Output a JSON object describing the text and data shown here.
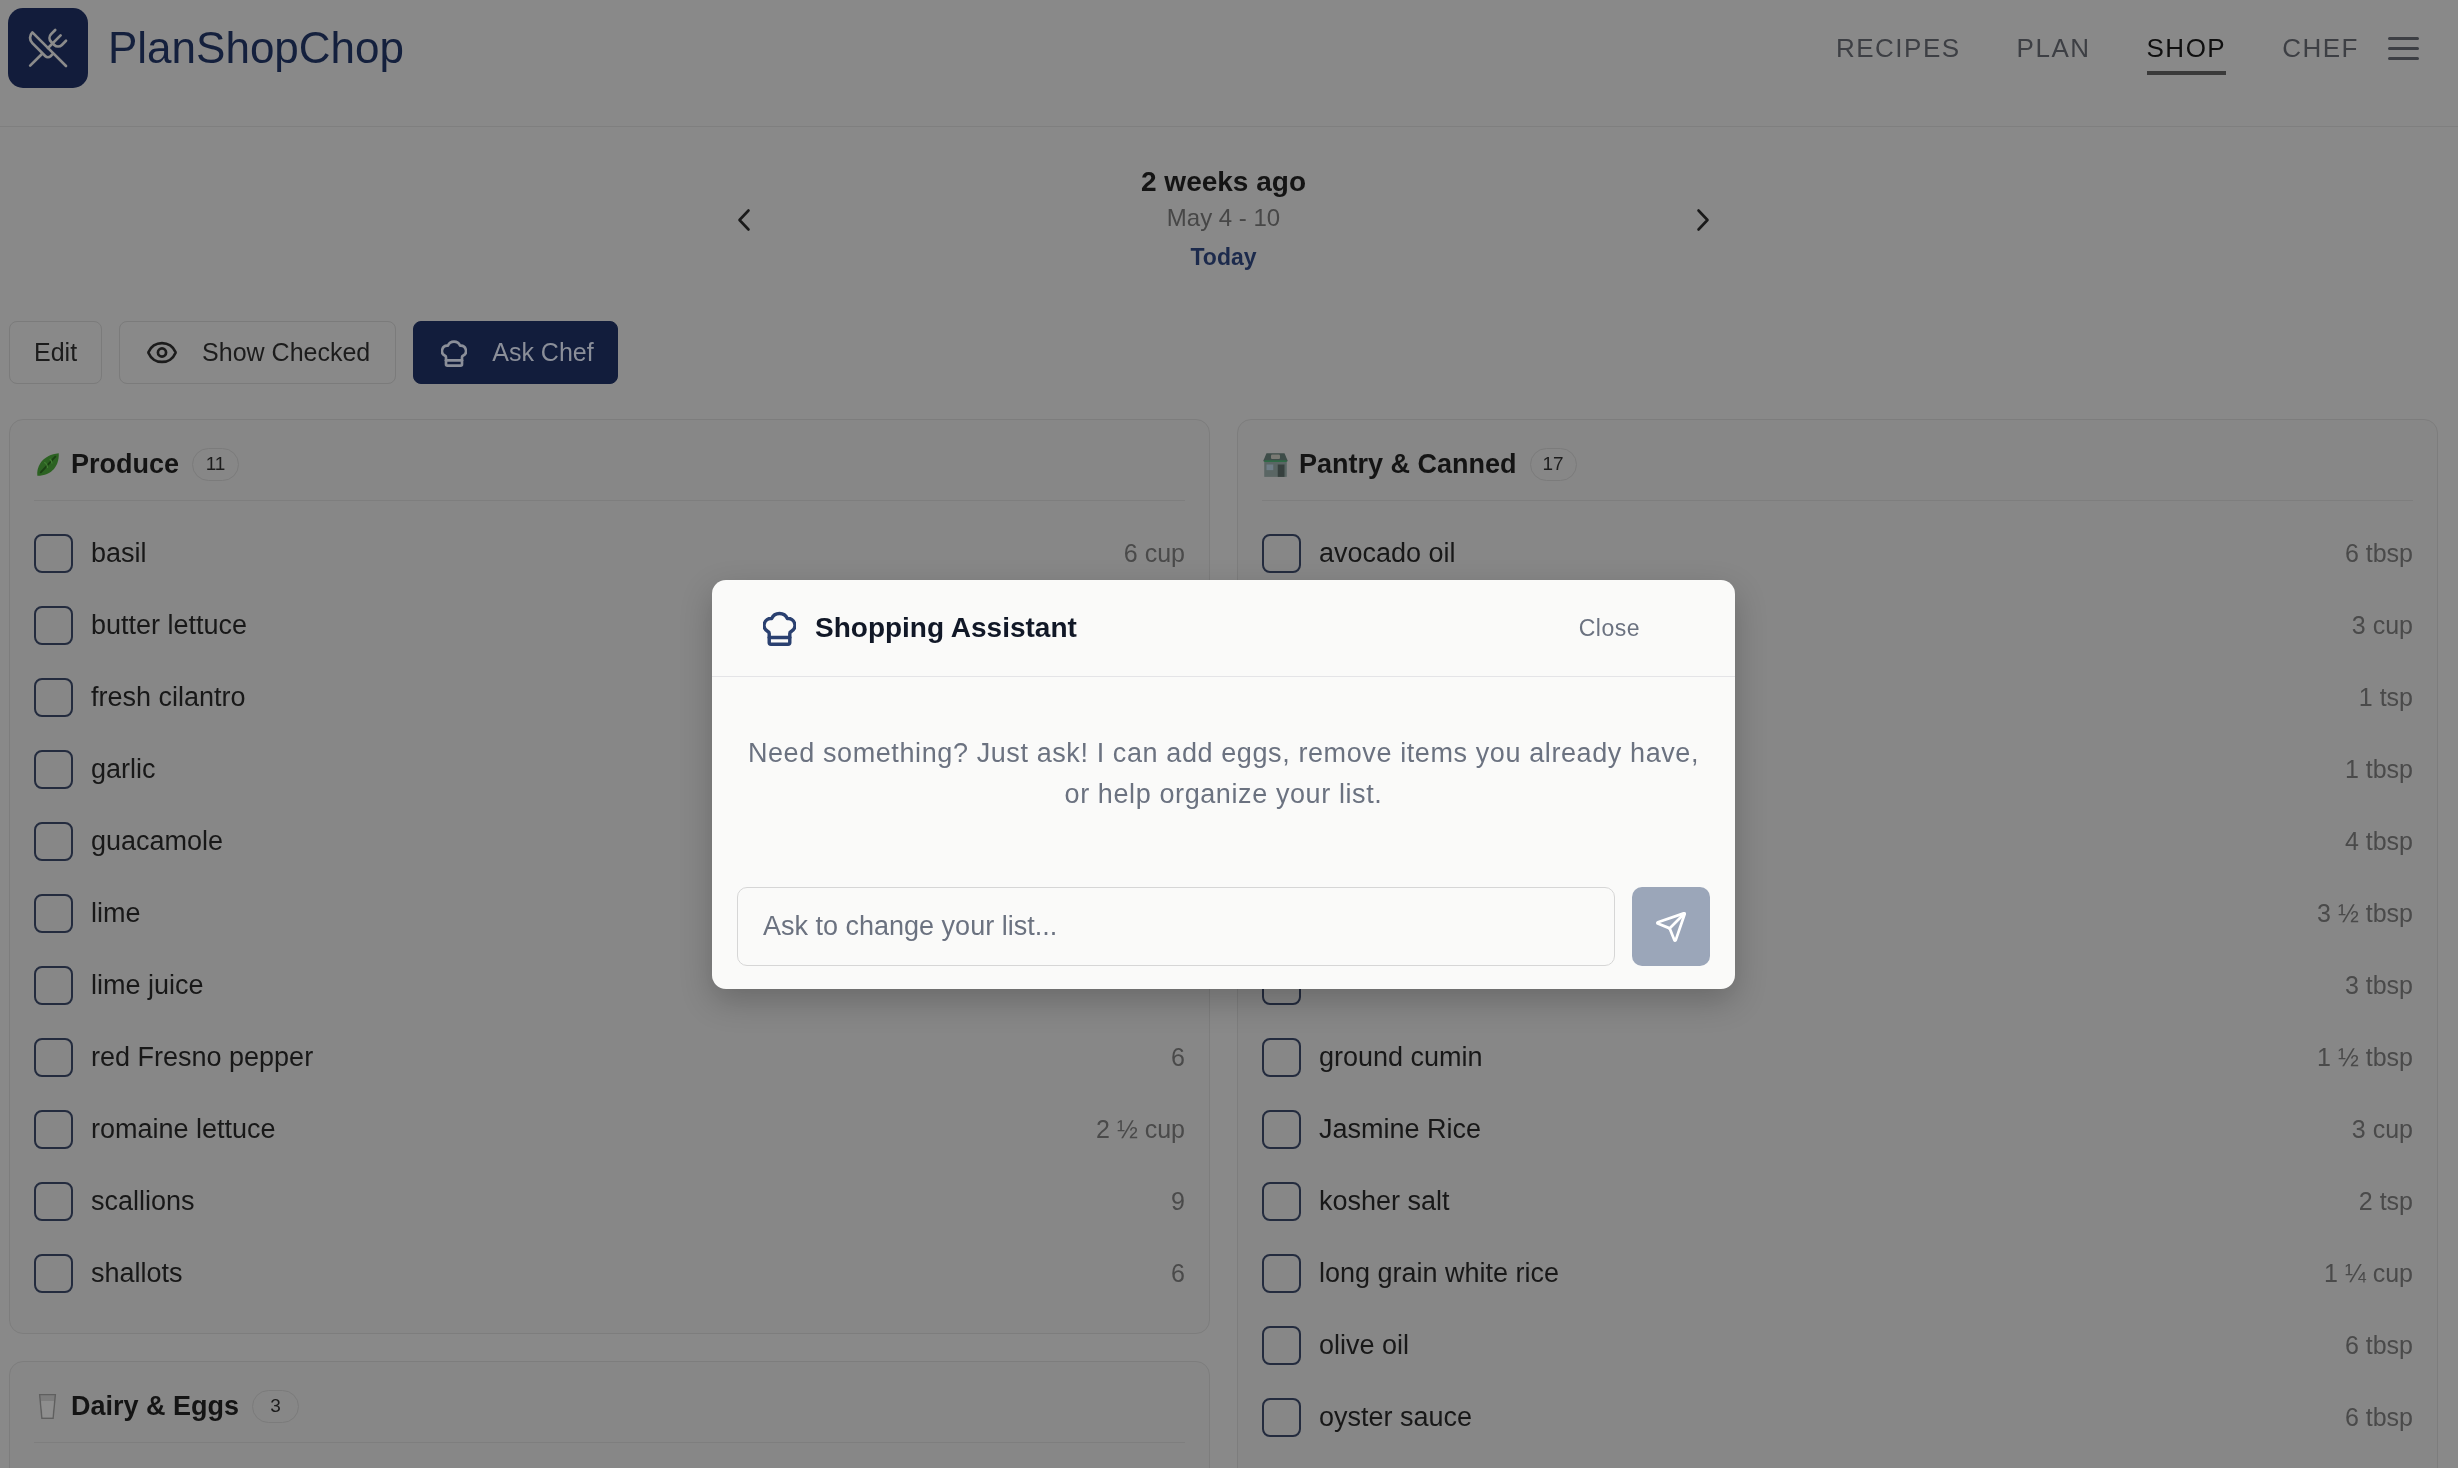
{
  "header": {
    "brand": "PlanShopChop",
    "nav": [
      {
        "label": "RECIPES",
        "selected": false
      },
      {
        "label": "PLAN",
        "selected": false
      },
      {
        "label": "SHOP",
        "selected": true
      },
      {
        "label": "CHEF",
        "selected": false
      }
    ]
  },
  "week": {
    "title": "2 weeks ago",
    "range": "May 4 - 10",
    "today": "Today"
  },
  "actions": [
    {
      "label": "Edit",
      "kind": "text"
    },
    {
      "label": "Show Checked",
      "kind": "toggle"
    },
    {
      "label": "Ask Chef",
      "kind": "assistant"
    }
  ],
  "columns": [
    {
      "categories": [
        {
          "kind": "produce",
          "title": "Produce",
          "count": "11",
          "items": [
            {
              "name": "basil",
              "checked": false,
              "quantity": "6 cup"
            },
            {
              "name": "butter lettuce",
              "checked": false
            },
            {
              "name": "fresh cilantro",
              "checked": false
            },
            {
              "name": "garlic",
              "checked": false
            },
            {
              "name": "guacamole",
              "checked": false
            },
            {
              "name": "lime",
              "checked": false
            },
            {
              "name": "lime juice",
              "checked": false
            },
            {
              "name": "red Fresno pepper",
              "checked": false,
              "quantity": "6"
            },
            {
              "name": "romaine lettuce",
              "checked": false,
              "quantity": "2 ½ cup"
            },
            {
              "name": "scallions",
              "checked": false,
              "quantity": "9"
            },
            {
              "name": "shallots",
              "checked": false,
              "quantity": "6"
            }
          ]
        },
        {
          "kind": "dairy",
          "title": "Dairy & Eggs",
          "count": "3"
        }
      ]
    },
    {
      "categories": [
        {
          "kind": "pantry",
          "title": "Pantry & Canned",
          "count": "17",
          "items": [
            {
              "name": "avocado oil",
              "checked": false,
              "quantity": "6 tbsp"
            },
            {
              "quantity": "3 cup"
            },
            {
              "quantity": "1 tsp"
            },
            {
              "quantity": "1 tbsp"
            },
            {
              "quantity": "4 tbsp"
            },
            {
              "quantity": "3 ½ tbsp"
            },
            {
              "checked": false,
              "quantity": "3 tbsp"
            },
            {
              "name": "ground cumin",
              "checked": false,
              "quantity": "1 ½ tbsp"
            },
            {
              "name": "Jasmine Rice",
              "checked": false,
              "quantity": "3 cup"
            },
            {
              "name": "kosher salt",
              "checked": false,
              "quantity": "2 tsp"
            },
            {
              "name": "long grain white rice",
              "checked": false,
              "quantity": "1 ¼ cup"
            },
            {
              "name": "olive oil",
              "checked": false,
              "quantity": "6 tbsp"
            },
            {
              "name": "oyster sauce",
              "checked": false,
              "quantity": "6 tbsp"
            }
          ]
        }
      ]
    }
  ],
  "assistant": {
    "title": "Shopping Assistant",
    "close": "Close",
    "message": "Need something? Just ask! I can add eggs, remove items you already have, or help organize your list.",
    "input": {
      "placeholder": "Ask to change your list..."
    },
    "send": {
      "disabled": true
    }
  }
}
